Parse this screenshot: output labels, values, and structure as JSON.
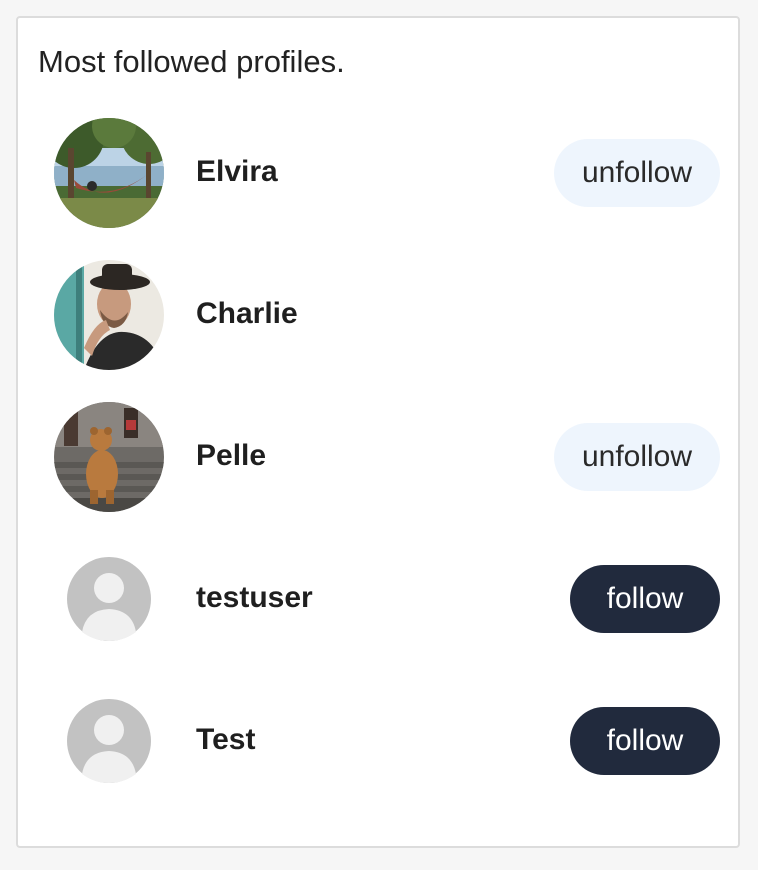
{
  "heading": "Most followed profiles.",
  "colors": {
    "follow_bg": "#212a3d",
    "unfollow_bg": "#eef5fd",
    "card_border": "#dcdcdc"
  },
  "profiles": [
    {
      "name": "Elvira",
      "avatar": "photo-hammock",
      "button": "unfollow"
    },
    {
      "name": "Charlie",
      "avatar": "photo-man-hat",
      "button": null
    },
    {
      "name": "Pelle",
      "avatar": "photo-bear-statue",
      "button": "unfollow"
    },
    {
      "name": "testuser",
      "avatar": "default-avatar-icon",
      "button": "follow"
    },
    {
      "name": "Test",
      "avatar": "default-avatar-icon",
      "button": "follow"
    }
  ]
}
